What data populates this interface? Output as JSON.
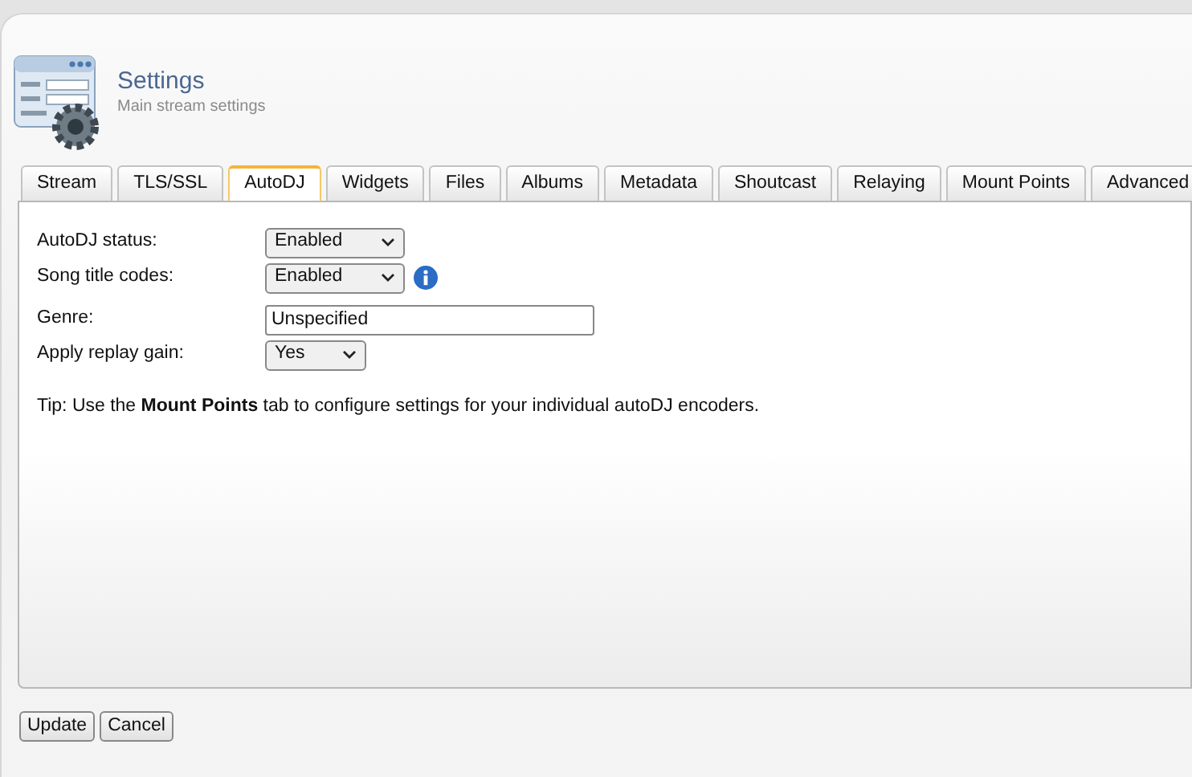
{
  "header": {
    "title": "Settings",
    "subtitle": "Main stream settings"
  },
  "tabs": [
    {
      "label": "Stream",
      "selected": false
    },
    {
      "label": "TLS/SSL",
      "selected": false
    },
    {
      "label": "AutoDJ",
      "selected": true
    },
    {
      "label": "Widgets",
      "selected": false
    },
    {
      "label": "Files",
      "selected": false
    },
    {
      "label": "Albums",
      "selected": false
    },
    {
      "label": "Metadata",
      "selected": false
    },
    {
      "label": "Shoutcast",
      "selected": false
    },
    {
      "label": "Relaying",
      "selected": false
    },
    {
      "label": "Mount Points",
      "selected": false
    },
    {
      "label": "Advanced",
      "selected": false
    }
  ],
  "fields": [
    {
      "label": "AutoDJ status:",
      "kind": "select",
      "value": "Enabled",
      "info": false
    },
    {
      "label": "Song title codes:",
      "kind": "select",
      "value": "Enabled",
      "info": true
    },
    {
      "label": "Genre:",
      "kind": "text",
      "value": "Unspecified",
      "info": false
    },
    {
      "label": "Apply replay gain:",
      "kind": "select",
      "value": "Yes",
      "info": false
    }
  ],
  "tip": "Tip: Use the **Mount Points** tab to configure settings for your individual autoDJ encoders.",
  "buttons": [
    "Update",
    "Cancel"
  ]
}
